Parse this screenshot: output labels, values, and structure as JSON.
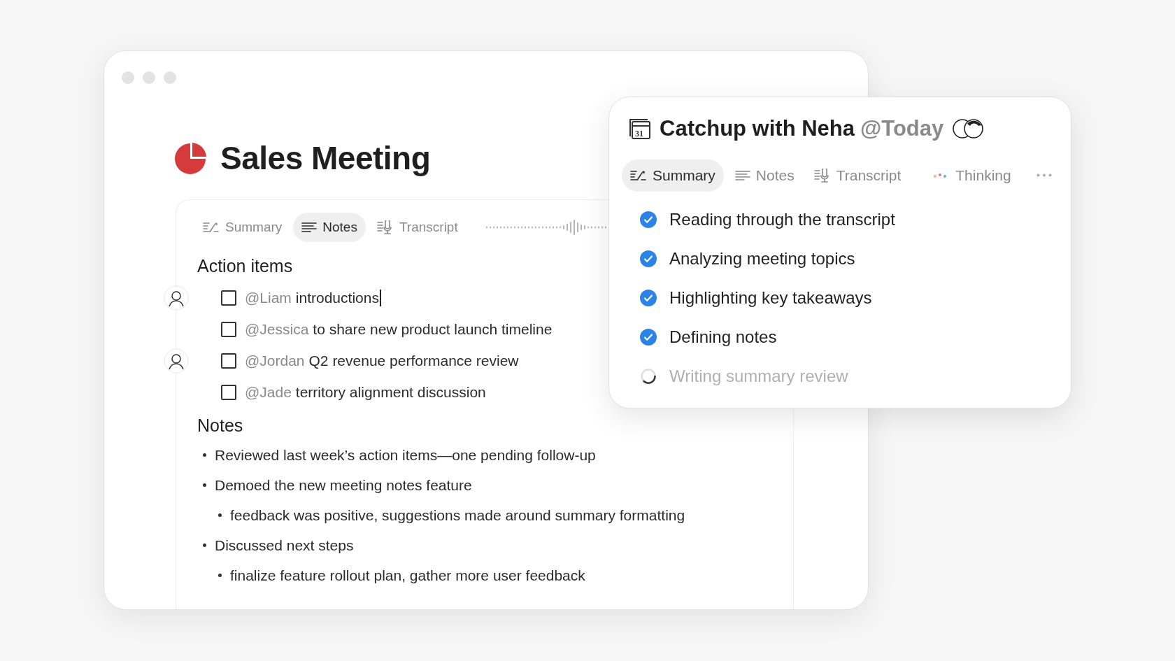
{
  "meeting_window": {
    "title": "Sales Meeting",
    "tabs": [
      {
        "kind": "summary",
        "label": "Summary",
        "selected": false
      },
      {
        "kind": "notes",
        "label": "Notes",
        "selected": true
      },
      {
        "kind": "transcript",
        "label": "Transcript",
        "selected": false
      }
    ],
    "action_items": {
      "heading": "Action items",
      "items": [
        {
          "mention": "@Liam",
          "text": "introductions",
          "checked": false,
          "avatar": true,
          "editing": true
        },
        {
          "mention": "@Jessica",
          "text": "to share new product launch timeline",
          "checked": false,
          "avatar": false,
          "editing": false
        },
        {
          "mention": "@Jordan",
          "text": "Q2 revenue performance review",
          "checked": false,
          "avatar": true,
          "editing": false
        },
        {
          "mention": "@Jade",
          "text": "territory alignment discussion",
          "checked": false,
          "avatar": false,
          "editing": false
        }
      ]
    },
    "notes": {
      "heading": "Notes",
      "bullets": [
        {
          "text": "Reviewed last week’s action items—one pending follow-up"
        },
        {
          "text": "Demoed the new meeting notes feature",
          "children": [
            {
              "text": "feedback was positive, suggestions made around summary formatting"
            }
          ]
        },
        {
          "text": "Discussed next steps",
          "children": [
            {
              "text": "finalize feature rollout plan, gather more user feedback"
            }
          ]
        }
      ]
    }
  },
  "summary_panel": {
    "calendar_day": "31",
    "title": "Catchup with Neha",
    "date_mention": "@Today",
    "tabs": [
      {
        "kind": "summary",
        "label": "Summary",
        "selected": true
      },
      {
        "kind": "notes",
        "label": "Notes",
        "selected": false
      },
      {
        "kind": "transcript",
        "label": "Transcript",
        "selected": false
      }
    ],
    "status": "Thinking",
    "steps": [
      {
        "label": "Reading through the transcript",
        "done": true
      },
      {
        "label": "Analyzing meeting topics",
        "done": true
      },
      {
        "label": "Highlighting key takeaways",
        "done": true
      },
      {
        "label": "Defining notes",
        "done": true
      },
      {
        "label": "Writing summary review",
        "done": false
      }
    ]
  }
}
